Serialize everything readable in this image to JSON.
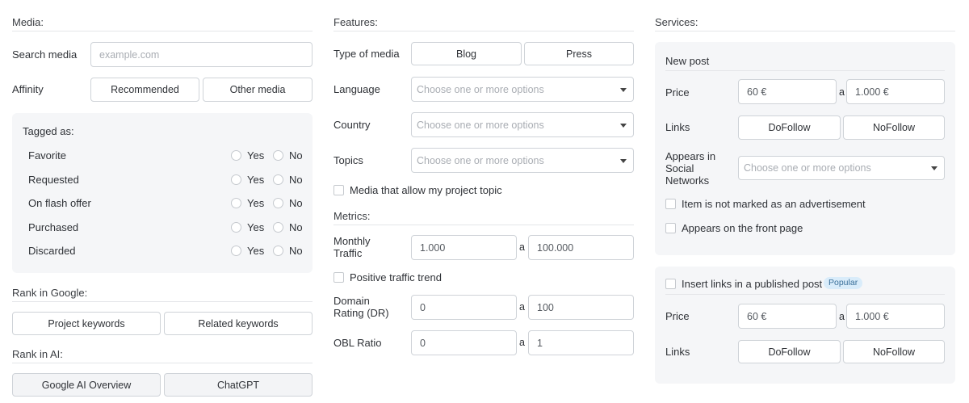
{
  "media": {
    "title": "Media:",
    "search": {
      "label": "Search media",
      "placeholder": "example.com"
    },
    "affinity": {
      "label": "Affinity",
      "options": [
        "Recommended",
        "Other media"
      ]
    },
    "tagged": {
      "title": "Tagged as:",
      "yes": "Yes",
      "no": "No",
      "rows": [
        "Favorite",
        "Requested",
        "On flash offer",
        "Purchased",
        "Discarded"
      ]
    },
    "rank_google": {
      "title": "Rank in Google:",
      "options": [
        "Project keywords",
        "Related keywords"
      ]
    },
    "rank_ai": {
      "title": "Rank in AI:",
      "options": [
        "Google AI Overview",
        "ChatGPT"
      ]
    }
  },
  "features": {
    "title": "Features:",
    "type_of_media": {
      "label": "Type of media",
      "options": [
        "Blog",
        "Press"
      ]
    },
    "language": {
      "label": "Language",
      "placeholder": "Choose one or more options"
    },
    "country": {
      "label": "Country",
      "placeholder": "Choose one or more options"
    },
    "topics": {
      "label": "Topics",
      "placeholder": "Choose one or more options"
    },
    "allow_topic": "Media that allow my project topic",
    "metrics": {
      "title": "Metrics:",
      "monthly_traffic": {
        "label": "Monthly Traffic",
        "min": "1.000",
        "max": "100.000"
      },
      "positive_trend": "Positive traffic trend",
      "domain_rating": {
        "label": "Domain Rating (DR)",
        "min": "0",
        "max": "100"
      },
      "obl_ratio": {
        "label": "OBL Ratio",
        "min": "0",
        "max": "1"
      },
      "range_sep": "a"
    }
  },
  "services": {
    "title": "Services:",
    "new_post": {
      "title": "New post",
      "price": {
        "label": "Price",
        "min": "60 €",
        "max": "1.000 €"
      },
      "links": {
        "label": "Links",
        "options": [
          "DoFollow",
          "NoFollow"
        ]
      },
      "social": {
        "label": "Appears in Social Networks",
        "placeholder": "Choose one or more options"
      },
      "not_ad": "Item is not marked as an advertisement",
      "front_page": "Appears on the front page"
    },
    "published_post": {
      "title": "Insert links in a published post",
      "badge": "Popular",
      "price": {
        "label": "Price",
        "min": "60 €",
        "max": "1.000 €"
      },
      "links": {
        "label": "Links",
        "options": [
          "DoFollow",
          "NoFollow"
        ]
      }
    }
  }
}
